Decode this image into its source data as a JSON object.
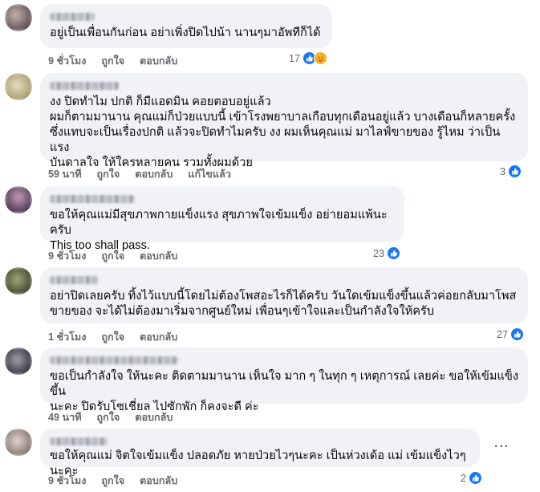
{
  "comments": [
    {
      "text": "อยู่เป็นเพื่อนกันก่อน อย่าเพิ่งปิดไปน้า นานๆมาอัพทีก็ได้",
      "time": "9 ชั่วโมง",
      "like": "ถูกใจ",
      "reply": "ตอบกลับ",
      "count": "17",
      "icons": [
        "like-icon",
        "care-icon"
      ],
      "avatar_color": "#7a6a6d"
    },
    {
      "text": "งง ปิดทำไม ปกติ ก็มีแอดมิน คอยตอบอยู่แล้ว\nผมก็ตามมานาน คุณแม่ก็ป่วยแบบนี้ เข้าโรงพยาบาลเกือบทุกเดือนอยู่แล้ว บางเดือนก็หลายครั้ง\nซึ่งแทบจะเป็นเรื่องปกติ แล้วจะปิดทำไมครับ งง ผมเห็นคุณแม่ มาไลฟ์ขายของ รู้ไหม ว่าเป็นแรง\nบันดาลใจ ให้ใครหลายคน รวมทั้งผมด้วย",
      "time": "59 นาที",
      "like": "ถูกใจ",
      "reply": "ตอบกลับ",
      "edited": "แก้ไขแล้ว",
      "count": "3",
      "icons": [
        "like-icon"
      ],
      "avatar_color": "#b0a47a"
    },
    {
      "text": "ขอให้คุณแม่มีสุขภาพกายแข็งแรง สุขภาพใจเข้มแข็ง อย่ายอมแพ้นะครับ\nThis too shall pass.",
      "time": "9 ชั่วโมง",
      "like": "ถูกใจ",
      "reply": "ตอบกลับ",
      "count": "23",
      "icons": [
        "like-icon"
      ],
      "avatar_color": "#6a4f6e"
    },
    {
      "text": "อย่าปิดเลยครับ ทิ้งไว้แบบนี้โดยไม่ต้องโพสอะไรก็ได้ครับ วันใดเข้มแข็งขึ้นแล้วค่อยกลับมาโพส\nขายของ จะได้ไม่ต้องมาเริ่มจากศูนย์ใหม่ เพื่อนๆเข้าใจและเป็นกำลังใจให้ครับ",
      "time": "1 ชั่วโมง",
      "like": "ถูกใจ",
      "reply": "ตอบกลับ",
      "count": "27",
      "icons": [
        "like-icon"
      ],
      "avatar_color": "#5a5e40"
    },
    {
      "text": "ขอเป็นกำลังใจ ให้นะคะ ติดตามมานาน เห็นใจ มาก ๆ ในทุก ๆ เหตุการณ์ เลยค่ะ ขอให้เข้มแข็งขึ้น\nนะคะ ปิดรับโซเชี่ยล ไปซักพัก ก็คงจะดี ค่ะ",
      "time": "49 นาที",
      "like": "ถูกใจ",
      "reply": "ตอบกลับ",
      "icons": [],
      "avatar_color": "#4f4e58"
    },
    {
      "text": "ขอให้คุณแม่ จิตใจเข้มแข็ง ปลอดภัย หายป่วยไวๆนะคะ เป็นห่วงเด้อ แม่ เข้มแข็งไวๆนะคะ",
      "time": "9 ชั่วโมง",
      "like": "ถูกใจ",
      "reply": "ตอบกลับ",
      "count": "2",
      "icons": [
        "like-icon"
      ],
      "avatar_color": "#9b8c86",
      "more": "···"
    }
  ]
}
